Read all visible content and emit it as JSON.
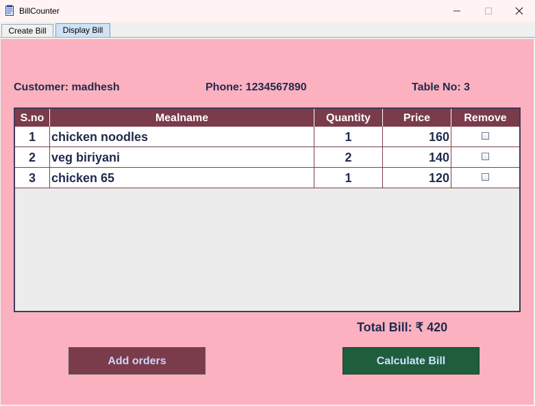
{
  "window": {
    "title": "BillCounter",
    "icon": "app-icon",
    "controls": {
      "minimize": "—",
      "maximize": "☐",
      "close": "✕"
    }
  },
  "tabs": [
    {
      "label": "Create Bill",
      "selected": false
    },
    {
      "label": "Display Bill",
      "selected": true
    }
  ],
  "info": {
    "customer": "Customer: madhesh",
    "phone": "Phone: 1234567890",
    "table_no": "Table No: 3"
  },
  "table": {
    "columns": [
      "S.no",
      "Mealname",
      "Quantity",
      "Price",
      "Remove"
    ],
    "rows": [
      {
        "sno": "1",
        "meal": "chicken noodles",
        "qty": "1",
        "price": "160",
        "remove": false
      },
      {
        "sno": "2",
        "meal": "veg biriyani",
        "qty": "2",
        "price": "140",
        "remove": false
      },
      {
        "sno": "3",
        "meal": "chicken 65",
        "qty": "1",
        "price": "120",
        "remove": false
      }
    ]
  },
  "total": "Total Bill: ₹ 420",
  "buttons": {
    "add_orders": "Add orders",
    "calculate_bill": "Calculate Bill"
  },
  "colors": {
    "panel_bg": "#fbb1c0",
    "header_bg": "#7a3c4b",
    "add_btn": "#7a3c4b",
    "calc_btn": "#1e5e3c",
    "text": "#1f2a4d"
  }
}
